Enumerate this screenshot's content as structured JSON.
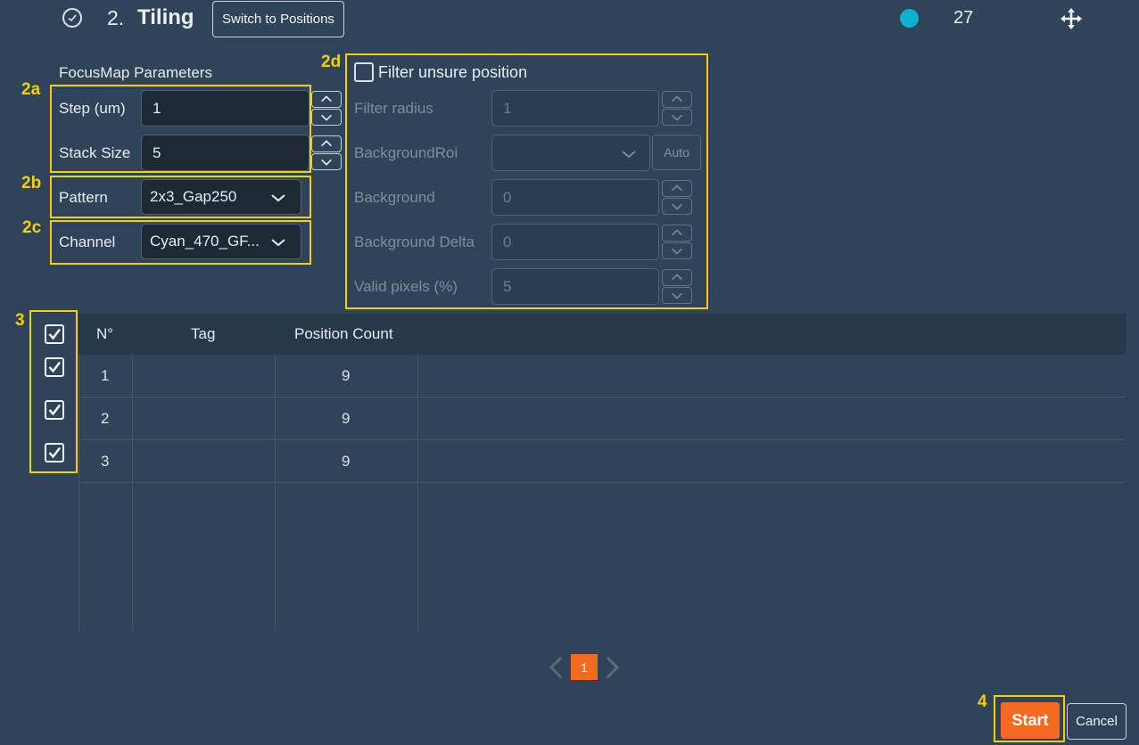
{
  "header": {
    "step_number": "2.",
    "title": "Tiling",
    "switch_label": "Switch to Positions",
    "count": "27",
    "status_color": "#0eb0cf"
  },
  "markers": {
    "m2a": "2a",
    "m2b": "2b",
    "m2c": "2c",
    "m2d": "2d",
    "m3": "3",
    "m4": "4"
  },
  "focusmap": {
    "section_label": "FocusMap Parameters",
    "step_label": "Step (um)",
    "step_value": "1",
    "stack_label": "Stack Size",
    "stack_value": "5",
    "pattern_label": "Pattern",
    "pattern_value": "2x3_Gap250",
    "channel_label": "Channel",
    "channel_value": "Cyan_470_GF..."
  },
  "filter": {
    "checkbox_label": "Filter unsure position",
    "radius_label": "Filter radius",
    "radius_value": "1",
    "bgroi_label": "BackgroundRoi",
    "bgroi_value": "",
    "auto_label": "Auto",
    "bg_label": "Background",
    "bg_value": "0",
    "bg_delta_label": "Background Delta",
    "bg_delta_value": "0",
    "valid_label": "Valid pixels (%)",
    "valid_value": "5"
  },
  "table": {
    "columns": [
      "N°",
      "Tag",
      "Position Count"
    ],
    "rows": [
      {
        "n": "1",
        "tag": "",
        "count": "9"
      },
      {
        "n": "2",
        "tag": "",
        "count": "9"
      },
      {
        "n": "3",
        "tag": "",
        "count": "9"
      }
    ]
  },
  "pagination": {
    "current": "1"
  },
  "footer": {
    "start_label": "Start",
    "cancel_label": "Cancel"
  }
}
